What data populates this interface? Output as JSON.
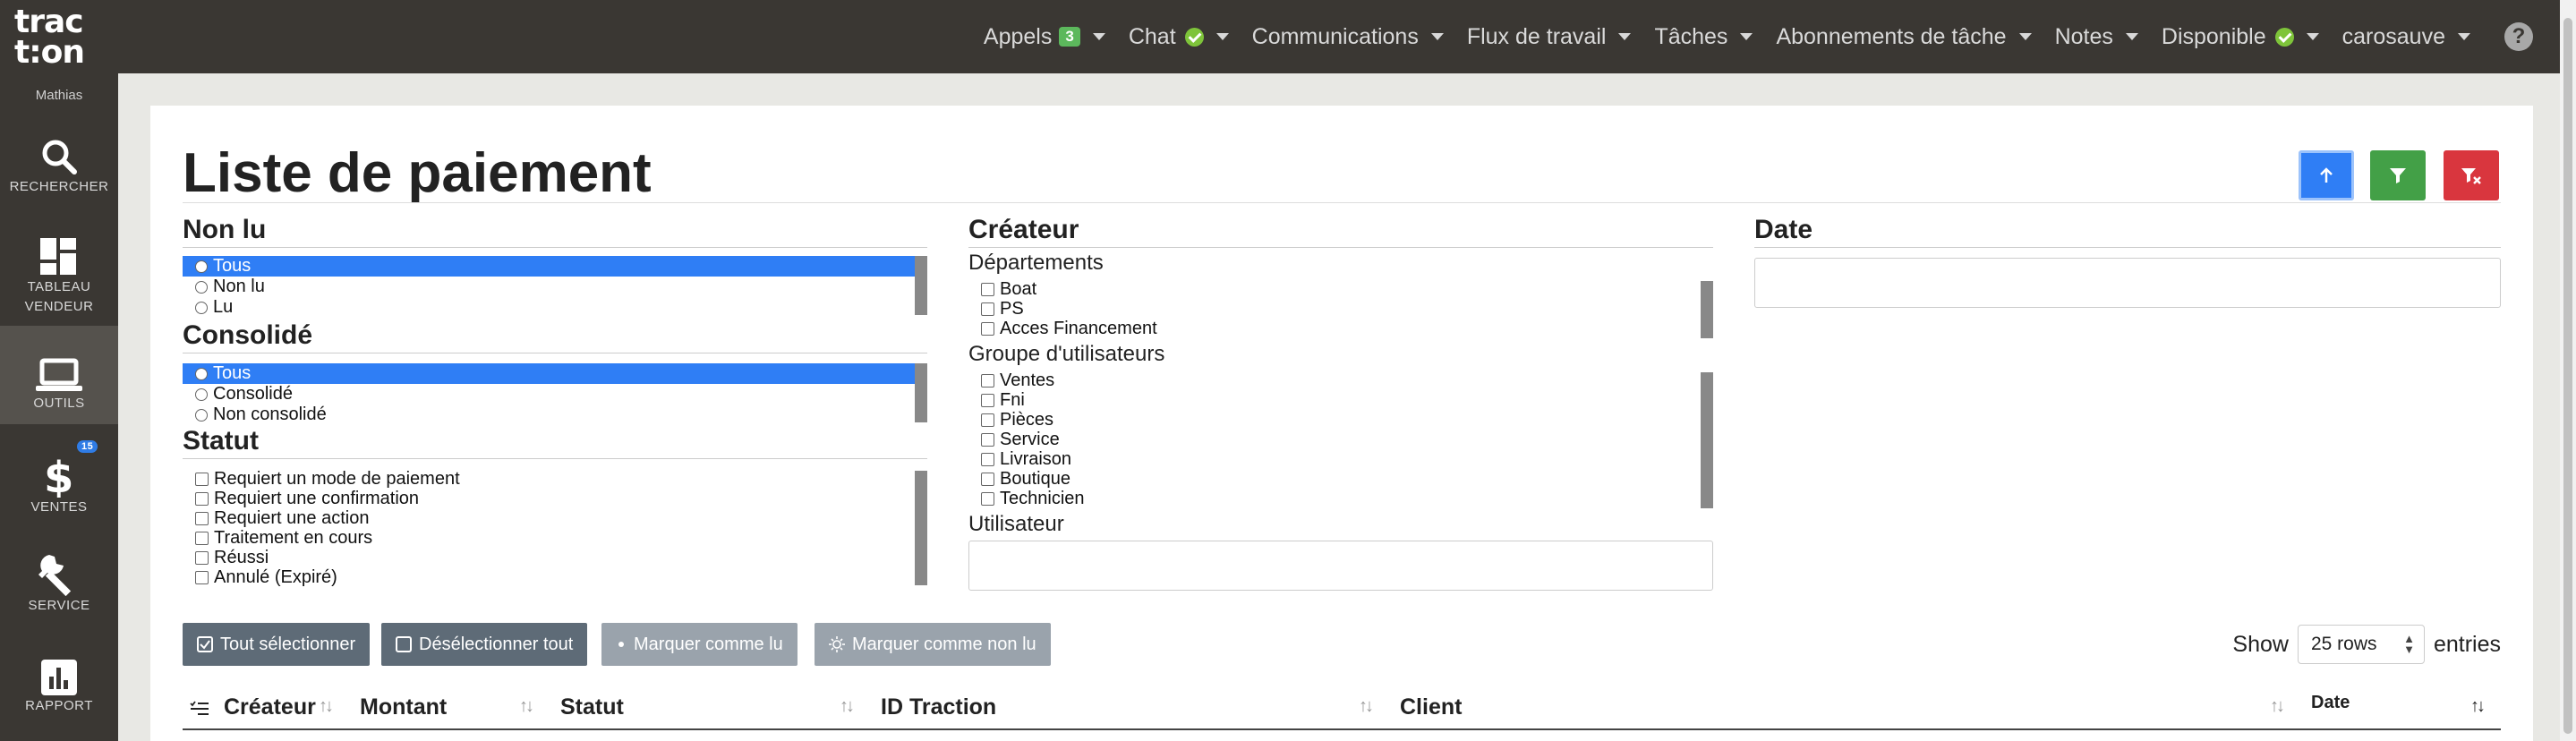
{
  "app": {
    "logo_line1": "trac",
    "logo_line2": "t:on",
    "user": "Mathias"
  },
  "sidebar": {
    "items": [
      {
        "label": "RECHERCHER",
        "icon": "search-icon"
      },
      {
        "label": "TABLEAU VENDEUR",
        "icon": "dashboard-icon"
      },
      {
        "label": "OUTILS",
        "icon": "laptop-icon",
        "active": true
      },
      {
        "label": "VENTES",
        "icon": "dollar-icon",
        "badge": "15"
      },
      {
        "label": "SERVICE",
        "icon": "wrench-icon"
      },
      {
        "label": "RAPPORT",
        "icon": "chart-icon"
      }
    ]
  },
  "topnav": {
    "items": [
      {
        "label": "Appels",
        "badge": "3"
      },
      {
        "label": "Chat",
        "status": "online"
      },
      {
        "label": "Communications"
      },
      {
        "label": "Flux de travail"
      },
      {
        "label": "Tâches"
      },
      {
        "label": "Abonnements de tâche"
      },
      {
        "label": "Notes"
      },
      {
        "label": "Disponible",
        "status": "online"
      },
      {
        "label": "carosauve"
      }
    ],
    "help": "?"
  },
  "page": {
    "title": "Liste de paiement"
  },
  "filters": {
    "non_lu": {
      "title": "Non lu",
      "options": [
        "Tous",
        "Non lu",
        "Lu"
      ],
      "selected": "Tous"
    },
    "consolide": {
      "title": "Consolidé",
      "options": [
        "Tous",
        "Consolidé",
        "Non consolidé"
      ],
      "selected": "Tous"
    },
    "statut": {
      "title": "Statut",
      "options": [
        "Requiert un mode de paiement",
        "Requiert une confirmation",
        "Requiert une action",
        "Traitement en cours",
        "Réussi",
        "Annulé (Expiré)"
      ]
    },
    "createur": {
      "title": "Créateur",
      "departements_label": "Départements",
      "departements": [
        "Boat",
        "PS",
        "Acces Financement"
      ],
      "groupe_label": "Groupe d'utilisateurs",
      "groupes": [
        "Ventes",
        "Fni",
        "Pièces",
        "Service",
        "Livraison",
        "Boutique",
        "Technicien"
      ],
      "utilisateur_label": "Utilisateur",
      "utilisateur_value": ""
    },
    "date": {
      "title": "Date",
      "value": ""
    }
  },
  "actions": {
    "select_all": "Tout sélectionner",
    "deselect_all": "Désélectionner tout",
    "mark_read": "Marquer comme lu",
    "mark_unread": "Marquer comme non lu"
  },
  "pagination": {
    "show": "Show",
    "rows": "25 rows",
    "entries": "entries"
  },
  "table": {
    "columns": [
      "Créateur",
      "Montant",
      "Statut",
      "ID Traction",
      "Client",
      "Date"
    ]
  },
  "colors": {
    "top_bar": "#3a3733",
    "upload_button": "#2f7ef5",
    "filter_button": "#43a047",
    "clear_filter_button": "#d9363e",
    "badge_green": "#5cb85c"
  }
}
